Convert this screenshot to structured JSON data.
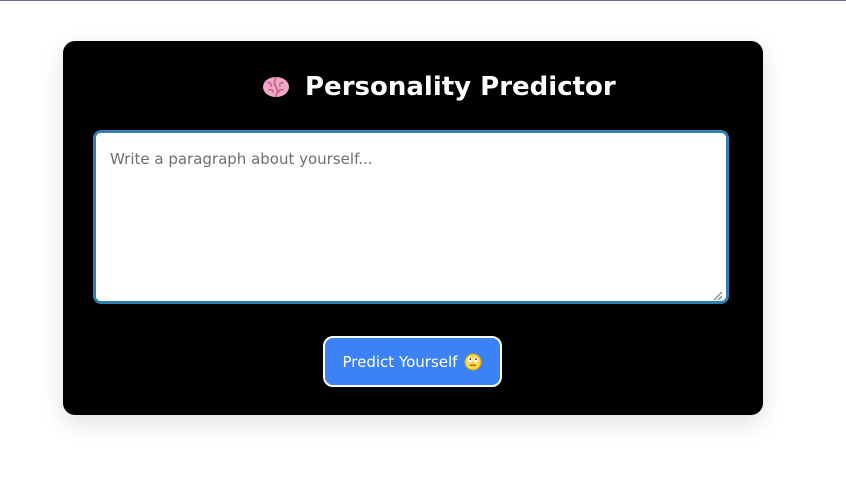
{
  "app": {
    "title": "Personality Predictor",
    "title_icon": "brain-icon"
  },
  "form": {
    "input_value": "",
    "input_placeholder": "Write a paragraph about yourself...",
    "predict_label": "Predict Yourself",
    "predict_icon": "face-with-rolling-eyes-icon"
  },
  "colors": {
    "page_background": "#ffffff",
    "card_background": "#000000",
    "input_border": "#2f7fb3",
    "button_background": "#3b82f6",
    "button_text": "#ffffff"
  }
}
